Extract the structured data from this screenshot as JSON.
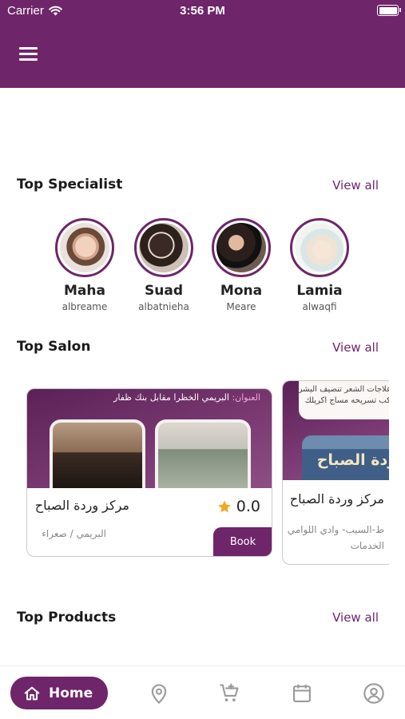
{
  "status_bar": {
    "carrier": "Carrier",
    "time": "3:56 PM"
  },
  "header": {
    "menu_icon": "hamburger-menu-icon"
  },
  "sections": {
    "specialists": {
      "title": "Top Specialist",
      "view_all": "View all"
    },
    "salons": {
      "title": "Top Salon",
      "view_all": "View all"
    },
    "products": {
      "title": "Top Products",
      "view_all": "View all"
    }
  },
  "specialists": [
    {
      "name": "Maha",
      "username": "albreame"
    },
    {
      "name": "Suad",
      "username": "albatnieha"
    },
    {
      "name": "Mona",
      "username": "Meare"
    },
    {
      "name": "Lamia",
      "username": "alwaqfi"
    }
  ],
  "salons": [
    {
      "banner_label": "العنوان:",
      "banner_address": "البريمي الخظرا مقابل بنك ظفار",
      "name": "مركز وردة الصباح",
      "location": "البريمي / صعراء",
      "rating": "0.0",
      "book_label": "Book"
    },
    {
      "banner_note_1": "ر علاجات الشعر تنضيف البشره",
      "banner_note_2": "ميكب تسريحه مساج اكريلك",
      "sign_text": "وردة الصباح",
      "name": "مركز وردة الصباح",
      "location_1": "ط-السيب- وادي اللوامي",
      "location_2": "الخدمات"
    }
  ],
  "tab_bar": {
    "home_label": "Home",
    "icons": [
      "home-icon",
      "location-pin-icon",
      "cart-add-icon",
      "calendar-icon",
      "profile-icon"
    ]
  },
  "colors": {
    "brand": "#6e2569",
    "star": "#f4a623",
    "banner_label": "#f4a7d9"
  }
}
